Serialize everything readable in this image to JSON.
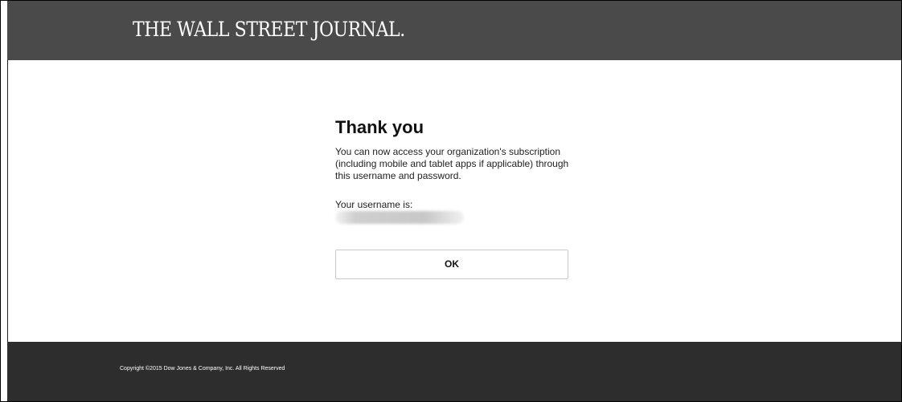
{
  "header": {
    "logo_text": "THE WALL STREET JOURNAL."
  },
  "main": {
    "title": "Thank you",
    "message": "You can now access your organization's subscription (including mobile and tablet apps if applicable) through this username and password.",
    "username_label": "Your username is:",
    "username_value_redacted": true,
    "ok_button_label": "OK"
  },
  "footer": {
    "copyright": "Copyright ©2015 Dow Jones & Company, Inc. All Rights Reserved"
  },
  "colors": {
    "header_bg": "#4a4a4a",
    "footer_bg": "#2d2d2d",
    "page_bg": "#ffffff",
    "button_border": "#c9c9c9"
  }
}
